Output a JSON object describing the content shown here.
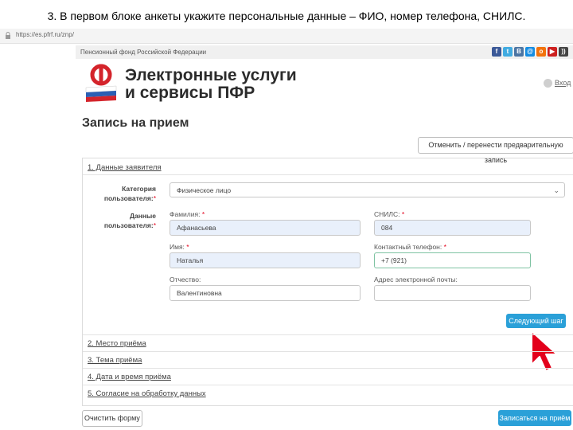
{
  "caption": "3. В первом блоке анкеты укажите персональные данные – ФИО, номер телефона, СНИЛС.",
  "browser": {
    "url": "https://es.pfrf.ru/znp/"
  },
  "header": {
    "org_name": "Пенсионный фонд Российской Федерации",
    "brand_line1": "Электронные услуги",
    "brand_line2": "и сервисы ПФР",
    "exit_label": "Вход",
    "social_icons": [
      "facebook-icon",
      "twitter-icon",
      "vk-icon",
      "mail-icon",
      "odnoklassniki-icon",
      "youtube-icon",
      "rss-icon"
    ]
  },
  "page": {
    "title": "Запись на прием",
    "cancel_button": "Отменить / перенести предварительную запись"
  },
  "form": {
    "section1": "1. Данные заявителя",
    "category_label_1": "Категория",
    "category_label_2": "пользователя:",
    "category_value": "Физическое лицо",
    "data_label_1": "Данные",
    "data_label_2": "пользователя:",
    "required_mark": "*",
    "lastname_label": "Фамилия:",
    "lastname_value": "Афанасьева",
    "snils_label": "СНИЛС:",
    "snils_value": "084",
    "firstname_label": "Имя:",
    "firstname_value": "Наталья",
    "phone_label": "Контактный телефон:",
    "phone_value": "+7 (921)",
    "patronymic_label": "Отчество:",
    "patronymic_value": "Валентиновна",
    "email_label": "Адрес электронной почты:",
    "email_value": "",
    "next_button": "Следующий шаг"
  },
  "sections": {
    "s2": "2. Место приёма",
    "s3": "3. Тема приёма",
    "s4": "4. Дата и время приёма",
    "s5": "5. Согласие на обработку данных"
  },
  "footer": {
    "clear_button": "Очистить форму",
    "submit_button": "Записаться на приём"
  },
  "colors": {
    "accent": "#2aa0d8",
    "brand_red": "#d4242b",
    "arrow_red": "#e3001b",
    "input_fill": "#e9f0fb"
  }
}
